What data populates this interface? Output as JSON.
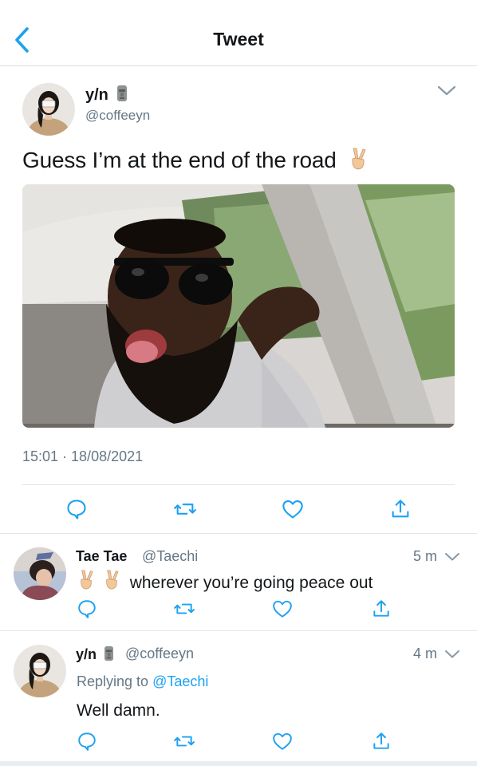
{
  "header": {
    "title": "Tweet",
    "back_icon": "chevron-left-icon",
    "accent": "#1da1f2"
  },
  "tweet": {
    "author_name": "y/n",
    "author_emoji": "moai-icon",
    "author_handle": "@coffeeyn",
    "text": "Guess I’m at the end of the road",
    "text_emoji": "victory-hand-icon",
    "timestamp": "15:01 · 18/08/2021",
    "actions": [
      "reply-icon",
      "retweet-icon",
      "like-icon",
      "share-icon"
    ]
  },
  "replies": [
    {
      "name": "Tae Tae",
      "handle": "@Taechi",
      "time": "5 m",
      "text": "wherever you’re going peace out",
      "text_emojis": [
        "victory-hand-icon",
        "victory-hand-icon"
      ]
    },
    {
      "name": "y/n",
      "name_emoji": "moai-icon",
      "handle": "@coffeeyn",
      "time": "4 m",
      "replying_prefix": "Replying to",
      "replying_to": "@Taechi",
      "text": "Well damn."
    }
  ]
}
